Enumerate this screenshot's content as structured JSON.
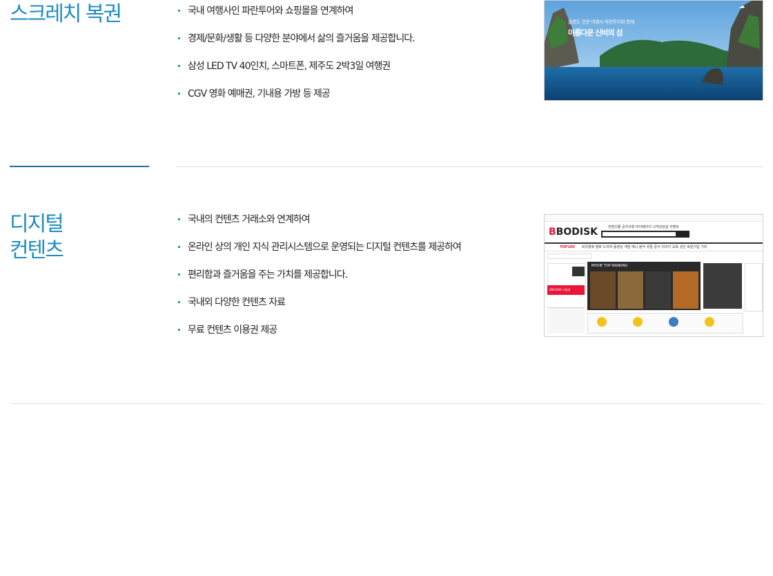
{
  "sections": [
    {
      "title_lines": [
        "스크레치 복권"
      ],
      "bullets": [
        "국내 여행사인 파란투어와 쇼핑몰을 연계하여",
        "경제/문화/생활 등 다양한 분야에서 삶의 즐거움을 제공합니다.",
        "삼성 LED TV 40인치, 스마트폰, 제주도 2박3일 여행권",
        "CGV 영화 예매권, 기내용 가방 등 제공"
      ],
      "image": {
        "caption_line1": "울릉도 전문 여행사 파란투어와 함께",
        "caption_line2": "아름다운 신비의 섬"
      }
    },
    {
      "title_lines": [
        "디지털",
        "컨텐츠"
      ],
      "bullets": [
        "국내의 컨텐츠 거래소와 연계하여",
        "온라인 상의 개인 지식 관리시스템으로 운영되는 디지털 컨텐츠를 제공하여",
        "편리함과 즐거움을 주는 가치를 제공합니다.",
        "국내외 다양한 컨텐츠 자료",
        "무료 컨텐츠 이용권 제공"
      ],
      "image": {
        "logo_prefix": "B",
        "logo_rest": "BODISK",
        "menu_top": "TOP100",
        "gnb": "컨텐츠몰  공지사항  마이페이지  고객상담실  이벤트",
        "menu_items": "외국영화  영화  드라마  동영상  게임  애니  음악  유틸  문서  이미지  교육  성인  회원가입  기타",
        "ranking_label": "MOVIE TOP RANKING",
        "red_bar_label": "BBODISK 이용권"
      }
    }
  ],
  "colors": {
    "accent": "#1d8cc0",
    "bullet": "#2a8fc4",
    "divider": "#dddddd",
    "divider_accent": "#1d6e97"
  }
}
